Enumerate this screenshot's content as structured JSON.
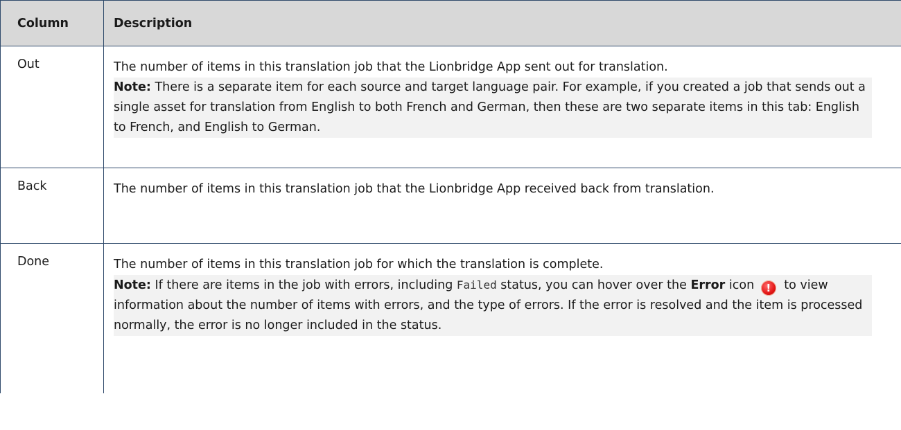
{
  "table": {
    "headers": {
      "column": "Column",
      "description": "Description"
    },
    "rows": {
      "out": {
        "name": "Out",
        "description": "The number of items in this translation job that the Lionbridge App sent out for translation.",
        "note_label": "Note:",
        "note_text": " There is a separate item for each source and target language pair. For example, if you created a job that sends out a single asset for translation from English to both French and German, then these are two separate items in this tab: English to French, and English to German."
      },
      "back": {
        "name": "Back",
        "description": "The number of items in this translation job that the Lionbridge App received back from translation."
      },
      "done": {
        "name": "Done",
        "description": "The number of items in this translation job for which the translation is complete.",
        "note_label": "Note:",
        "note_part1": " If there are items in the job with errors, including ",
        "note_code": "Failed",
        "note_part2": " status, you can hover over the ",
        "note_error_label": "Error",
        "note_part3": " icon ",
        "error_icon_glyph": "!",
        "error_icon_name": "error-icon",
        "note_part4": " to view information about the number of items with errors, and the type of errors. If the error is resolved and the item is processed normally, the error is no longer included in the status."
      }
    }
  }
}
